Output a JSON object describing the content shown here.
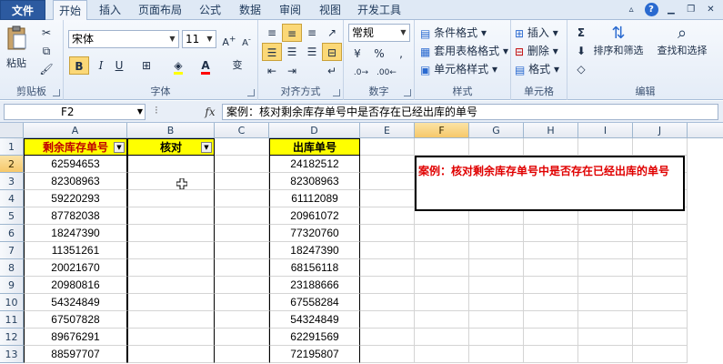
{
  "tabs": [
    {
      "label": "文件"
    },
    {
      "label": "开始"
    },
    {
      "label": "插入"
    },
    {
      "label": "页面布局"
    },
    {
      "label": "公式"
    },
    {
      "label": "数据"
    },
    {
      "label": "审阅"
    },
    {
      "label": "视图"
    },
    {
      "label": "开发工具"
    }
  ],
  "ribbon": {
    "clipboard": {
      "label": "剪贴板",
      "paste": "粘贴"
    },
    "font": {
      "label": "字体",
      "name": "宋体",
      "size": "11",
      "bold": "B",
      "italic": "I",
      "underline": "U"
    },
    "alignment": {
      "label": "对齐方式"
    },
    "number": {
      "label": "数字",
      "format": "常规"
    },
    "styles": {
      "label": "样式",
      "conditional": "条件格式",
      "table": "套用表格格式",
      "cell": "单元格样式"
    },
    "cells": {
      "label": "单元格",
      "insert": "插入",
      "delete": "删除",
      "format": "格式"
    },
    "editing": {
      "label": "编辑",
      "sort": "排序和筛选",
      "find": "查找和选择"
    }
  },
  "formula_bar": {
    "name_box": "F2",
    "fx": "fx",
    "content": "案例：核对剩余库存单号中是否存在已经出库的单号"
  },
  "columns": [
    "A",
    "B",
    "C",
    "D",
    "E",
    "F",
    "G",
    "H",
    "I",
    "J"
  ],
  "rows": [
    "1",
    "2",
    "3",
    "4",
    "5",
    "6",
    "7",
    "8",
    "9",
    "10",
    "11",
    "12",
    "13"
  ],
  "headers": {
    "a": "剩余库存单号",
    "b": "核对",
    "d": "出库单号"
  },
  "col_a": [
    "62594653",
    "82308963",
    "59220293",
    "87782038",
    "18247390",
    "11351261",
    "20021670",
    "20980816",
    "54324849",
    "67507828",
    "89676291",
    "88597707"
  ],
  "col_d": [
    "24182512",
    "82308963",
    "61112089",
    "20961072",
    "77320760",
    "18247390",
    "68156118",
    "23188666",
    "67558284",
    "54324849",
    "62291569",
    "72195807"
  ],
  "note": "案例：核对剩余库存单号中是否存在已经出库的单号",
  "colors": {
    "header_fill": "#ffff00",
    "header_text": "#c00000",
    "note_text": "#e00000",
    "file_tab": "#2c5aa0"
  }
}
